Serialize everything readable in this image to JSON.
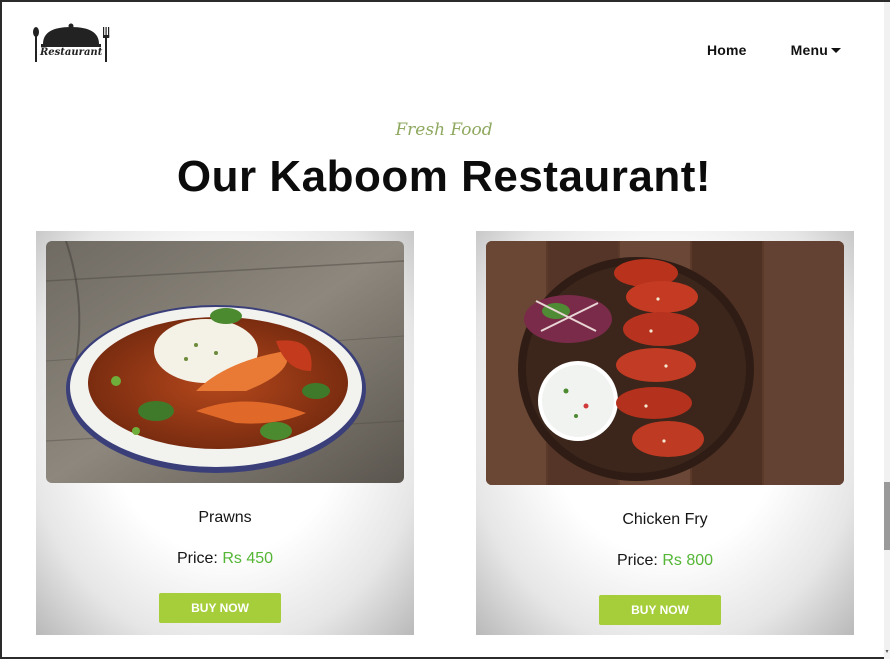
{
  "header": {
    "logo_text": "Restaurant",
    "nav": [
      {
        "label": "Home"
      },
      {
        "label": "Menu",
        "has_dropdown": true
      }
    ]
  },
  "hero": {
    "eyebrow": "Fresh Food",
    "title": "Our Kaboom Restaurant!"
  },
  "price_label": "Price:",
  "accent_color": "#a5ce3a",
  "price_color": "#55b636",
  "cards": [
    {
      "name": "Prawns",
      "price": "Rs 450",
      "button": "BUY NOW",
      "image": "prawn-curry-image"
    },
    {
      "name": "Chicken Fry",
      "price": "Rs 800",
      "button": "BUY NOW",
      "image": "chicken-wings-image"
    }
  ]
}
